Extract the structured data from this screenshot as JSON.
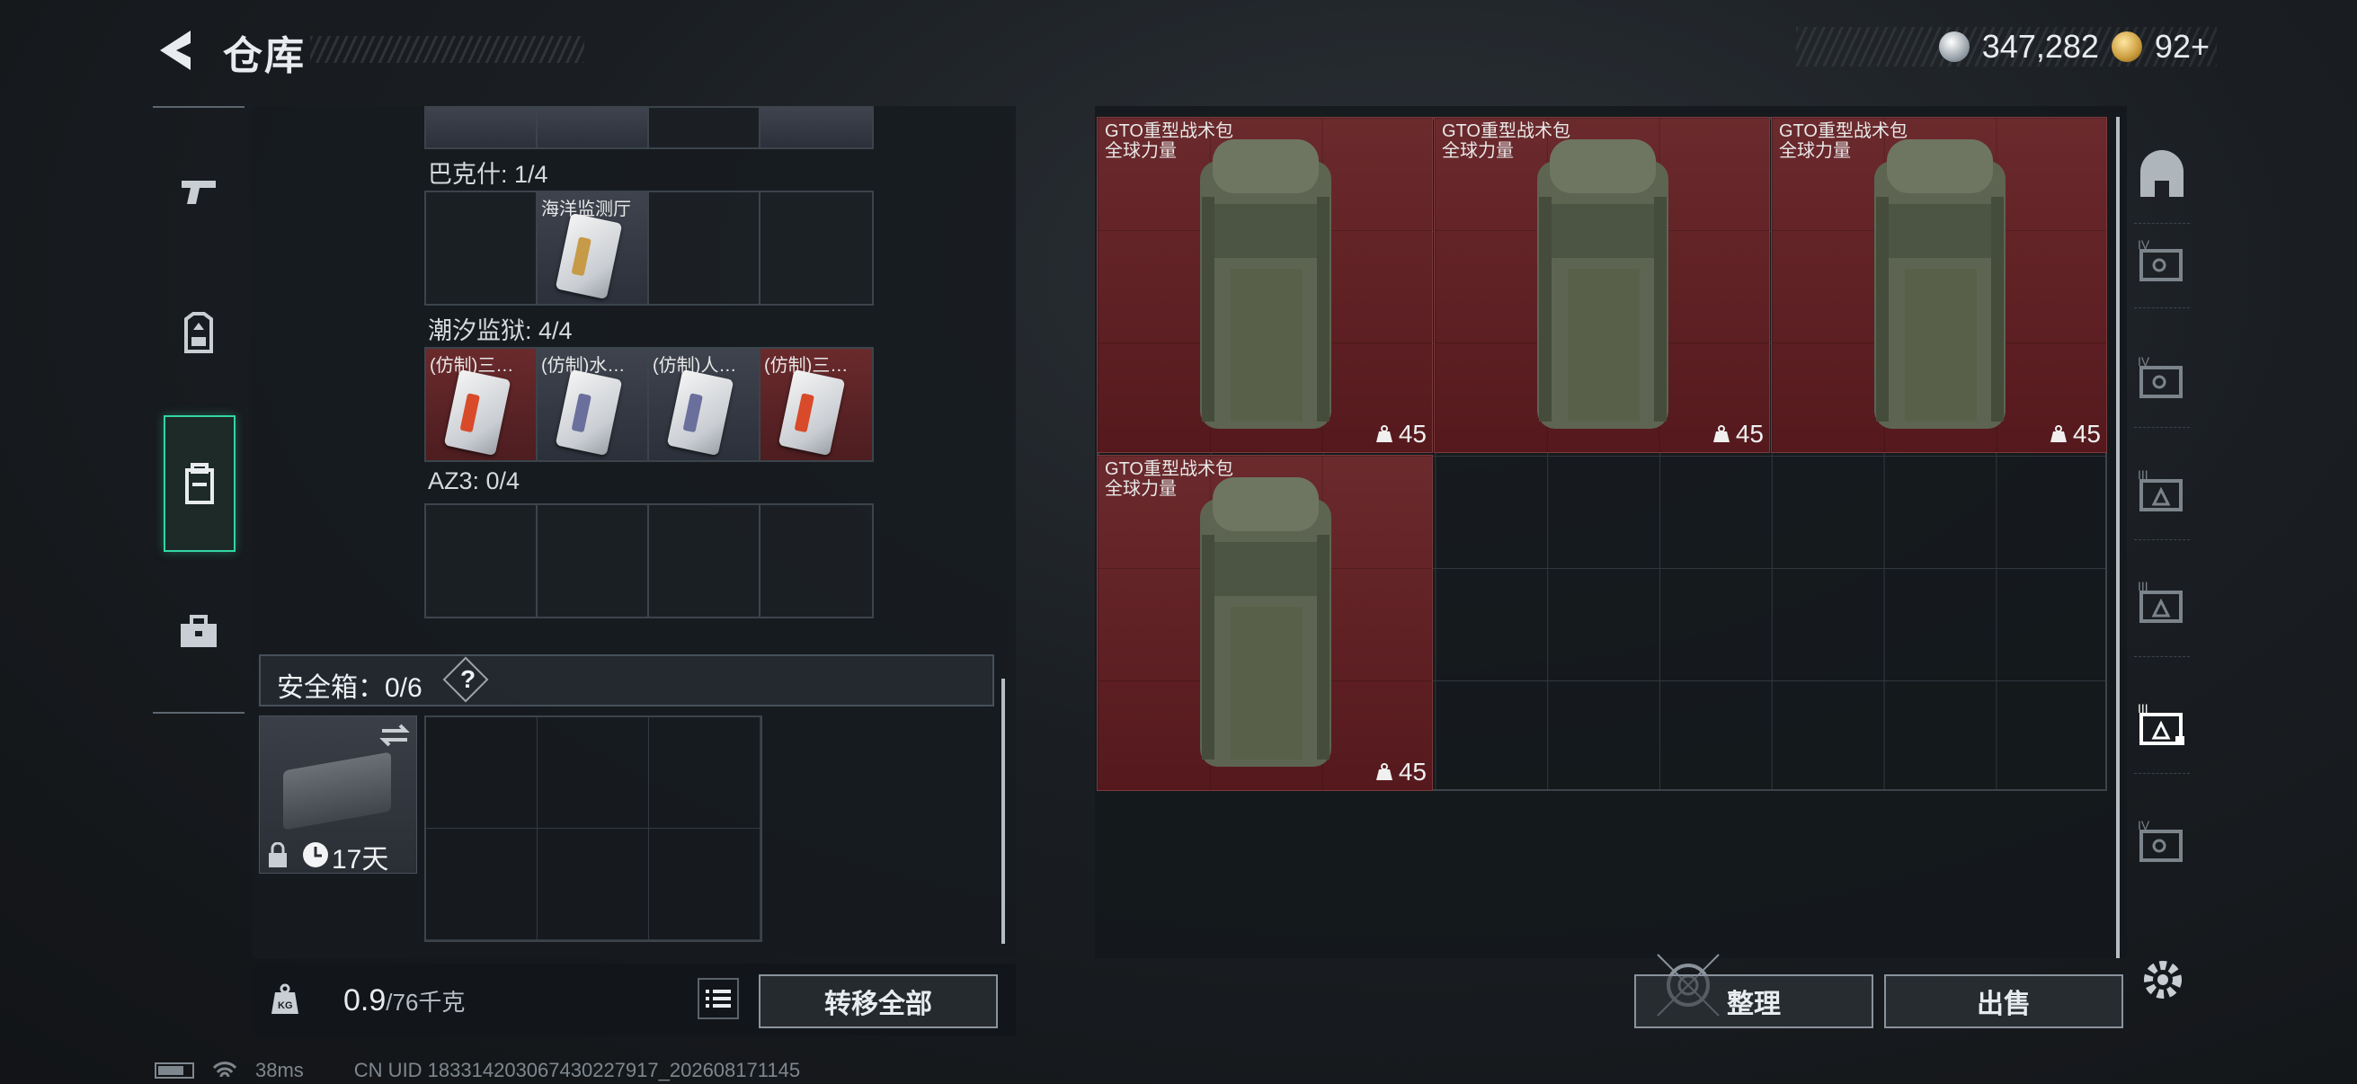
{
  "header": {
    "title": "仓库",
    "currency": {
      "coins": "347,282",
      "premium": "92+"
    }
  },
  "left_tabs": [
    {
      "name": "weapons",
      "icon": "pistol-icon",
      "active": false
    },
    {
      "name": "armor",
      "icon": "helmet-icon",
      "active": false
    },
    {
      "name": "backpack",
      "icon": "backpack-icon",
      "active": true
    },
    {
      "name": "case",
      "icon": "briefcase-icon",
      "active": false
    }
  ],
  "sections": [
    {
      "label": "巴克什: 1/4",
      "slots": [
        {
          "name": "",
          "filled": false
        },
        {
          "name": "海洋监测厅",
          "filled": true,
          "tint": "gray"
        },
        {
          "name": "",
          "filled": false
        },
        {
          "name": "",
          "filled": false
        }
      ]
    },
    {
      "label": "潮汐监狱: 4/4",
      "slots": [
        {
          "name": "(仿制)三…",
          "filled": true,
          "tint": "red"
        },
        {
          "name": "(仿制)水…",
          "filled": true,
          "tint": "gray"
        },
        {
          "name": "(仿制)人…",
          "filled": true,
          "tint": "gray"
        },
        {
          "name": "(仿制)三…",
          "filled": true,
          "tint": "red"
        }
      ]
    },
    {
      "label": "AZ3: 0/4",
      "slots": [
        {
          "name": "",
          "filled": false
        },
        {
          "name": "",
          "filled": false
        },
        {
          "name": "",
          "filled": false
        },
        {
          "name": "",
          "filled": false
        }
      ]
    }
  ],
  "safe_box": {
    "label": "安全箱：0/6",
    "help": "?",
    "days": "17天"
  },
  "weight": {
    "value": "0.9",
    "max": "/76千克"
  },
  "buttons": {
    "transfer_all": "转移全部",
    "sort": "整理",
    "sell": "出售"
  },
  "stash_items": [
    {
      "name": "GTO重型战术包",
      "sub": "全球力量",
      "weight": "45"
    },
    {
      "name": "GTO重型战术包",
      "sub": "全球力量",
      "weight": "45"
    },
    {
      "name": "GTO重型战术包",
      "sub": "全球力量",
      "weight": "45"
    },
    {
      "name": "GTO重型战术包",
      "sub": "全球力量",
      "weight": "45"
    }
  ],
  "right_tabs": [
    "helmet-tier-icon",
    "armor-tier-IV-icon",
    "armor-tier-IV-icon",
    "armor-tier-III-icon",
    "armor-tier-III-icon",
    "armor-tier-III-selected-icon",
    "armor-tier-IV-icon"
  ],
  "status": {
    "ping": "38ms",
    "uid": "CN UID 18331420306743022791​7_202608171145"
  },
  "colors": {
    "accent": "#32d6a5",
    "item_red": "#5e2125",
    "button_border": "#8a939c"
  }
}
